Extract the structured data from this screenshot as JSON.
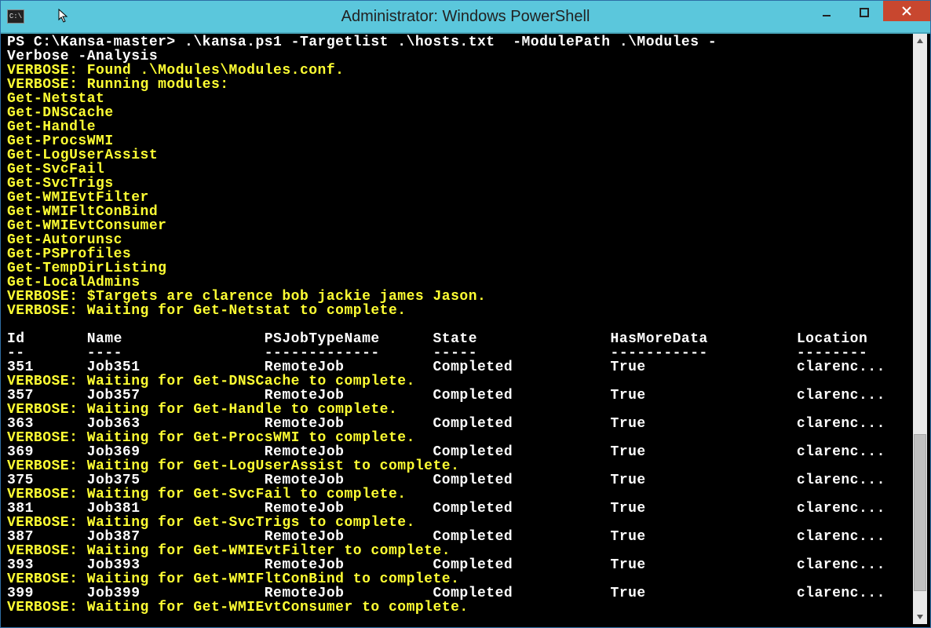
{
  "window": {
    "title": "Administrator: Windows PowerShell",
    "sysicon_text": "C:\\"
  },
  "prompt_line1": "PS C:\\Kansa-master> .\\kansa.ps1 -Targetlist .\\hosts.txt  -ModulePath .\\Modules -",
  "prompt_line2": "Verbose -Analysis",
  "verbose_found": "VERBOSE: Found .\\Modules\\Modules.conf.",
  "verbose_running": "VERBOSE: Running modules:",
  "modules": [
    "Get-Netstat",
    "Get-DNSCache",
    "Get-Handle",
    "Get-ProcsWMI",
    "Get-LogUserAssist",
    "Get-SvcFail",
    "Get-SvcTrigs",
    "Get-WMIEvtFilter",
    "Get-WMIFltConBind",
    "Get-WMIEvtConsumer",
    "Get-Autorunsc",
    "Get-PSProfiles",
    "Get-TempDirListing",
    "Get-LocalAdmins"
  ],
  "verbose_targets": "VERBOSE: $Targets are clarence bob jackie james Jason.",
  "verbose_wait_first": "VERBOSE: Waiting for Get-Netstat to complete.",
  "table_header": {
    "id": "Id",
    "name": "Name",
    "type": "PSJobTypeName",
    "state": "State",
    "hasmore": "HasMoreData",
    "location": "Location"
  },
  "table_sep": {
    "id": "--",
    "name": "----",
    "type": "-------------",
    "state": "-----",
    "hasmore": "-----------",
    "location": "--------"
  },
  "rows": [
    {
      "id": "351",
      "name": "Job351",
      "type": "RemoteJob",
      "state": "Completed",
      "hasmore": "True",
      "location": "clarenc...",
      "verbose_after": "VERBOSE: Waiting for Get-DNSCache to complete."
    },
    {
      "id": "357",
      "name": "Job357",
      "type": "RemoteJob",
      "state": "Completed",
      "hasmore": "True",
      "location": "clarenc...",
      "verbose_after": "VERBOSE: Waiting for Get-Handle to complete."
    },
    {
      "id": "363",
      "name": "Job363",
      "type": "RemoteJob",
      "state": "Completed",
      "hasmore": "True",
      "location": "clarenc...",
      "verbose_after": "VERBOSE: Waiting for Get-ProcsWMI to complete."
    },
    {
      "id": "369",
      "name": "Job369",
      "type": "RemoteJob",
      "state": "Completed",
      "hasmore": "True",
      "location": "clarenc...",
      "verbose_after": "VERBOSE: Waiting for Get-LogUserAssist to complete."
    },
    {
      "id": "375",
      "name": "Job375",
      "type": "RemoteJob",
      "state": "Completed",
      "hasmore": "True",
      "location": "clarenc...",
      "verbose_after": "VERBOSE: Waiting for Get-SvcFail to complete."
    },
    {
      "id": "381",
      "name": "Job381",
      "type": "RemoteJob",
      "state": "Completed",
      "hasmore": "True",
      "location": "clarenc...",
      "verbose_after": "VERBOSE: Waiting for Get-SvcTrigs to complete."
    },
    {
      "id": "387",
      "name": "Job387",
      "type": "RemoteJob",
      "state": "Completed",
      "hasmore": "True",
      "location": "clarenc...",
      "verbose_after": "VERBOSE: Waiting for Get-WMIEvtFilter to complete."
    },
    {
      "id": "393",
      "name": "Job393",
      "type": "RemoteJob",
      "state": "Completed",
      "hasmore": "True",
      "location": "clarenc...",
      "verbose_after": "VERBOSE: Waiting for Get-WMIFltConBind to complete."
    },
    {
      "id": "399",
      "name": "Job399",
      "type": "RemoteJob",
      "state": "Completed",
      "hasmore": "True",
      "location": "clarenc...",
      "verbose_after": "VERBOSE: Waiting for Get-WMIEvtConsumer to complete."
    }
  ],
  "cols": {
    "id": 0,
    "name": 9,
    "type": 29,
    "state": 48,
    "hasmore": 68,
    "location": 89
  }
}
